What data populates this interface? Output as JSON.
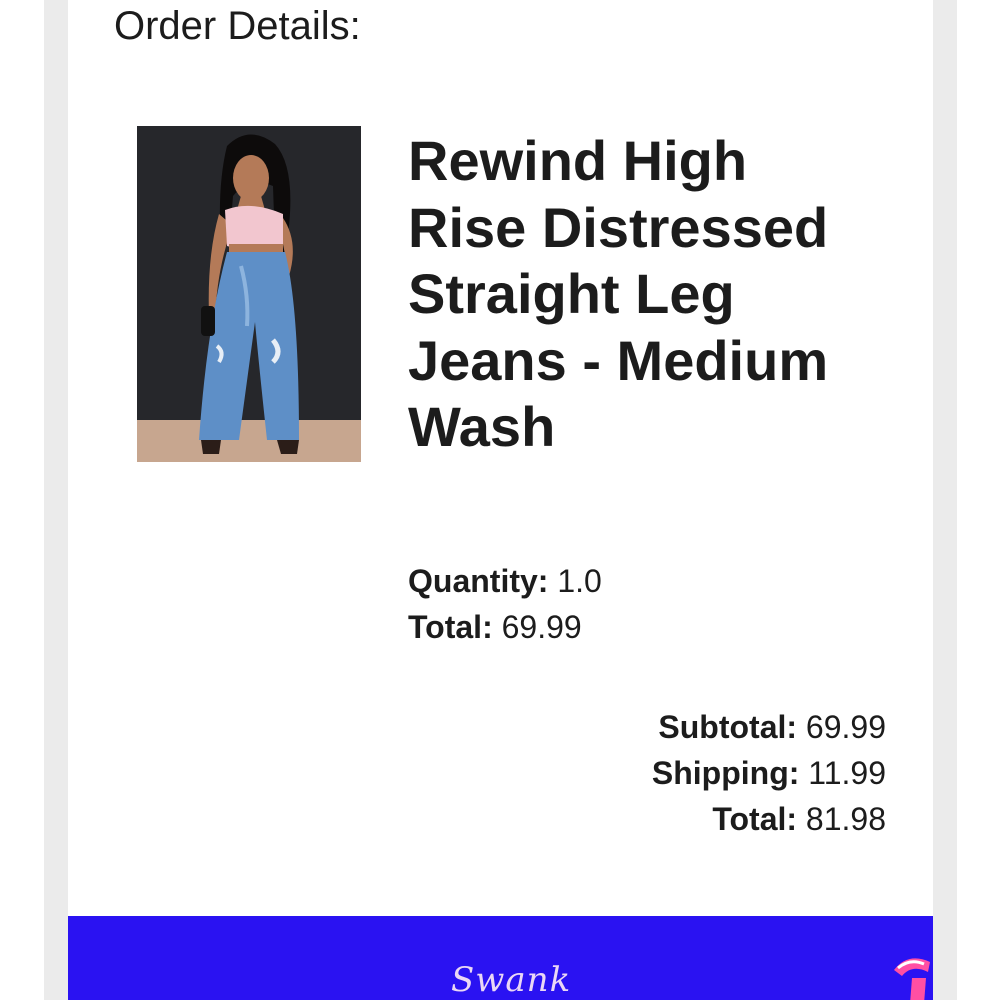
{
  "order": {
    "section_title": "Order Details:",
    "item": {
      "image_icon": "product-photo",
      "title": "Rewind High Rise Distressed Straight Leg Jeans - Medium Wash",
      "quantity_label": "Quantity:",
      "quantity_value": "1.0",
      "total_label": "Total:",
      "total_value": "69.99"
    },
    "summary": {
      "subtotal_label": "Subtotal:",
      "subtotal_value": "69.99",
      "shipping_label": "Shipping:",
      "shipping_value": "11.99",
      "total_label": "Total:",
      "total_value": "81.98"
    }
  },
  "banner": {
    "background_color": "#2a12f2",
    "logo_text": "Swank",
    "badge_icon": "brand-mark-icon"
  }
}
